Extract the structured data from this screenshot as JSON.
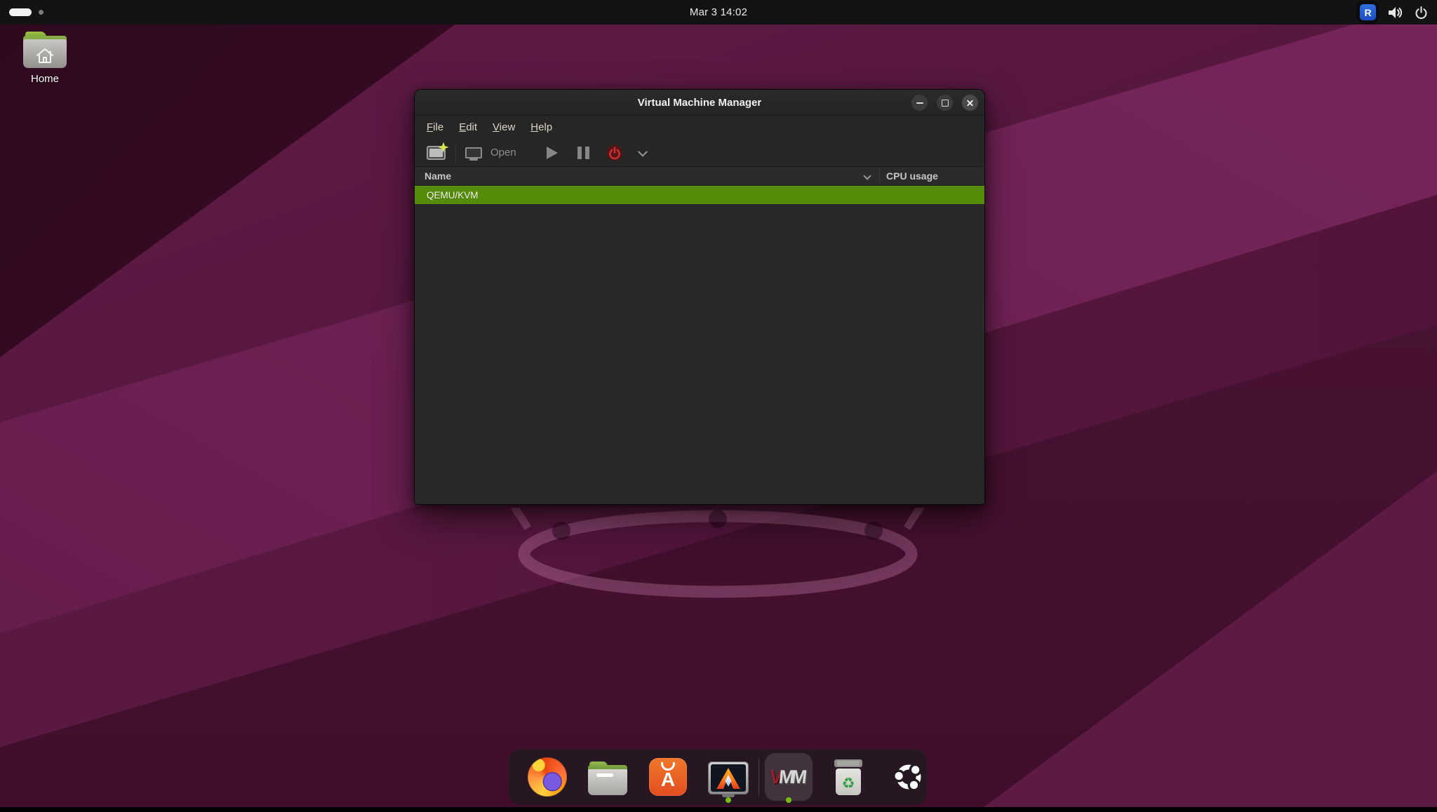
{
  "topbar": {
    "clock": "Mar 3 14:02",
    "tray": {
      "remmina_glyph": "R"
    }
  },
  "desktop": {
    "home_label": "Home"
  },
  "window": {
    "title": "Virtual Machine Manager",
    "menubar": {
      "items": [
        {
          "label": "File"
        },
        {
          "label": "Edit"
        },
        {
          "label": "View"
        },
        {
          "label": "Help"
        }
      ]
    },
    "toolbar": {
      "open_label": "Open"
    },
    "list": {
      "columns": {
        "name": "Name",
        "cpu": "CPU usage"
      },
      "rows": [
        {
          "name": "QEMU/KVM",
          "selected": true
        }
      ]
    }
  },
  "dock": {
    "app_center_letter": "A",
    "vmm_letters": [
      "V",
      "M",
      "M"
    ],
    "trash_glyph": "♻",
    "items": [
      {
        "id": "firefox",
        "running": false,
        "focused": false
      },
      {
        "id": "files",
        "running": false,
        "focused": false
      },
      {
        "id": "app-center",
        "running": false,
        "focused": false
      },
      {
        "id": "vm-console",
        "running": true,
        "focused": false
      },
      {
        "id": "virt-manager",
        "running": true,
        "focused": true
      },
      {
        "id": "trash",
        "running": false,
        "focused": false
      },
      {
        "id": "ubuntu-show-apps",
        "running": false,
        "focused": false
      }
    ]
  },
  "colors": {
    "selection_green": "#548c08",
    "running_dot_green": "#79bd17",
    "titlebar_bg": "#262626",
    "window_body_bg": "#282828",
    "topbar_bg": "#131214",
    "power_icon_red": "#c23434",
    "remmina_blue": "#2f6fe0"
  }
}
